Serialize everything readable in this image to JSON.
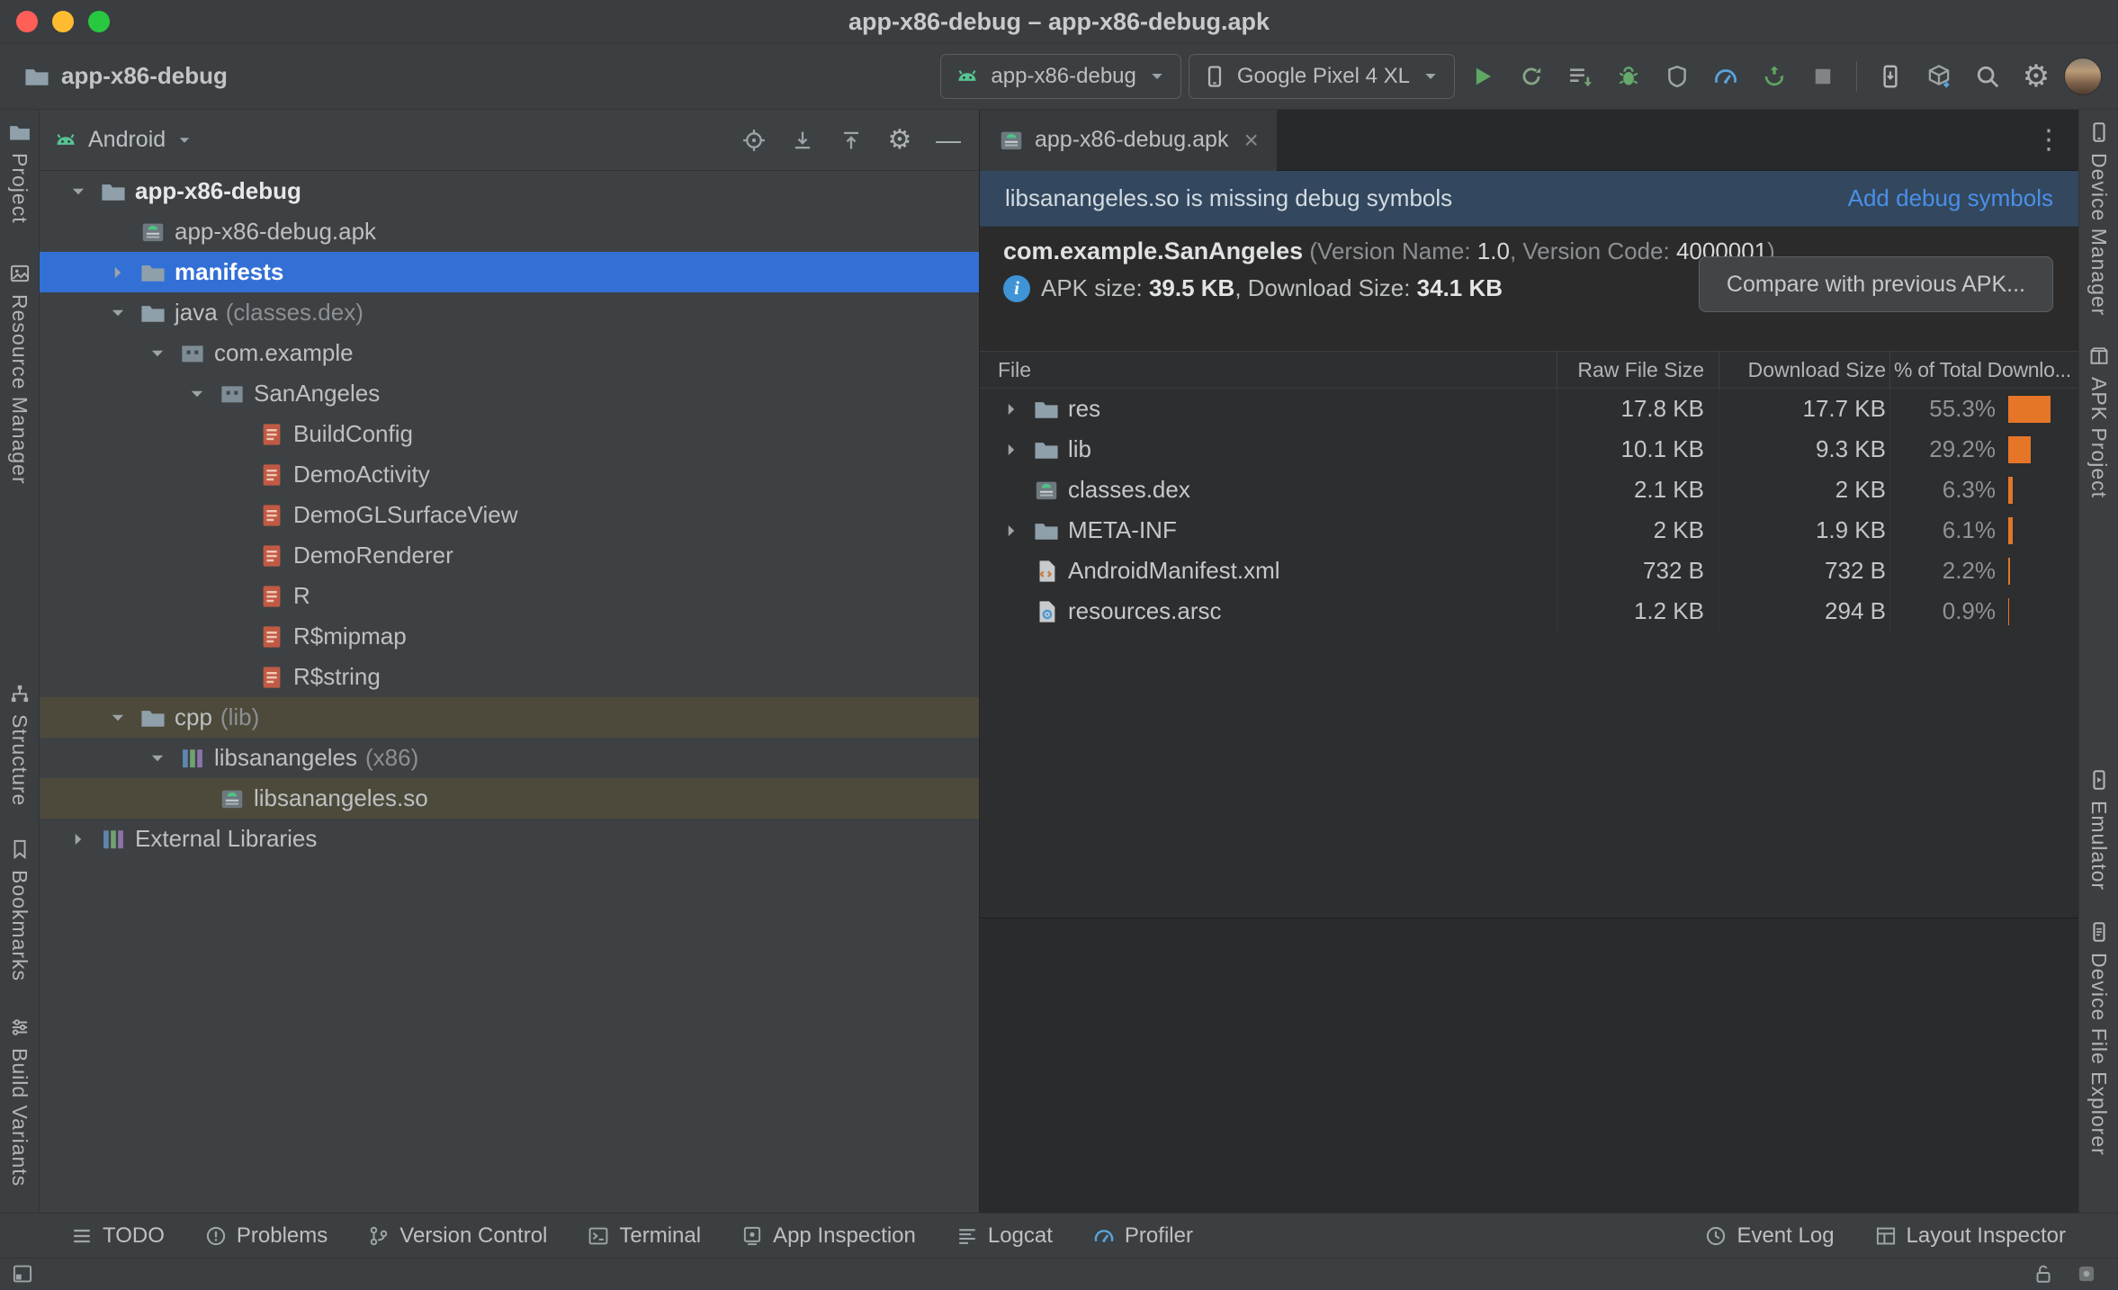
{
  "window": {
    "title": "app-x86-debug – app-x86-debug.apk"
  },
  "toolbar": {
    "project_name": "app-x86-debug",
    "run_config": "app-x86-debug",
    "device": "Google Pixel 4 XL",
    "action_icons": [
      "run",
      "rerun",
      "apply-changes",
      "debug",
      "coverage",
      "profiler",
      "sync",
      "stop",
      "running-devices",
      "device-manager",
      "search",
      "settings",
      "avatar"
    ]
  },
  "stripes": {
    "left": [
      {
        "name": "project",
        "label": "Project"
      },
      {
        "name": "resource-manager",
        "label": "Resource Manager"
      },
      {
        "name": "structure",
        "label": "Structure"
      },
      {
        "name": "bookmarks",
        "label": "Bookmarks"
      },
      {
        "name": "build-variants",
        "label": "Build Variants"
      }
    ],
    "right": [
      {
        "name": "device-manager",
        "label": "Device Manager"
      },
      {
        "name": "apk-project",
        "label": "APK Project"
      },
      {
        "name": "emulator",
        "label": "Emulator"
      },
      {
        "name": "device-file-explorer",
        "label": "Device File Explorer"
      }
    ]
  },
  "project_panel": {
    "view": "Android",
    "tree": [
      {
        "label": "app-x86-debug",
        "depth": 0,
        "chevron": "down",
        "icon": "folder",
        "bold": true
      },
      {
        "label": "app-x86-debug.apk",
        "depth": 1,
        "icon": "apk"
      },
      {
        "label": "manifests",
        "depth": 1,
        "chevron": "right",
        "icon": "folder",
        "bold": true,
        "state": "selected"
      },
      {
        "label": "java",
        "secondary": "(classes.dex)",
        "depth": 1,
        "chevron": "down",
        "icon": "folder"
      },
      {
        "label": "com.example",
        "depth": 2,
        "chevron": "down",
        "icon": "package"
      },
      {
        "label": "SanAngeles",
        "depth": 3,
        "chevron": "down",
        "icon": "package"
      },
      {
        "label": "BuildConfig",
        "depth": 4,
        "icon": "class"
      },
      {
        "label": "DemoActivity",
        "depth": 4,
        "icon": "class"
      },
      {
        "label": "DemoGLSurfaceView",
        "depth": 4,
        "icon": "class"
      },
      {
        "label": "DemoRenderer",
        "depth": 4,
        "icon": "class"
      },
      {
        "label": "R",
        "depth": 4,
        "icon": "class"
      },
      {
        "label": "R$mipmap",
        "depth": 4,
        "icon": "class"
      },
      {
        "label": "R$string",
        "depth": 4,
        "icon": "class"
      },
      {
        "label": "cpp",
        "secondary": "(lib)",
        "depth": 1,
        "chevron": "down",
        "icon": "folder",
        "state": "context"
      },
      {
        "label": "libsanangeles",
        "secondary": "(x86)",
        "depth": 2,
        "chevron": "down",
        "icon": "library"
      },
      {
        "label": "libsanangeles.so",
        "depth": 3,
        "icon": "apk",
        "state": "context"
      },
      {
        "label": "External Libraries",
        "depth": 0,
        "chevron": "right",
        "icon": "library"
      }
    ]
  },
  "editor": {
    "tab": "app-x86-debug.apk",
    "banner": {
      "message": "libsanangeles.so is missing debug symbols",
      "action": "Add debug symbols"
    },
    "summary": {
      "package": "com.example.SanAngeles",
      "meta_open": "(Version Name: ",
      "version_name": "1.0",
      "meta_mid": ", Version Code: ",
      "version_code": "4000001",
      "meta_close": ")",
      "apk_size_label": "APK size: ",
      "apk_size": "39.5 KB",
      "download_size_label": ", Download Size: ",
      "download_size": "34.1 KB",
      "compare_button": "Compare with previous APK..."
    },
    "table": {
      "columns": [
        "File",
        "Raw File Size",
        "Download Size",
        "% of Total Downlo..."
      ],
      "rows": [
        {
          "name": "res",
          "icon": "folder",
          "expandable": true,
          "raw": "17.8 KB",
          "download": "17.7 KB",
          "percent": "55.3%",
          "percent_value": 55.3
        },
        {
          "name": "lib",
          "icon": "folder",
          "expandable": true,
          "raw": "10.1 KB",
          "download": "9.3 KB",
          "percent": "29.2%",
          "percent_value": 29.2
        },
        {
          "name": "classes.dex",
          "icon": "dex",
          "expandable": false,
          "raw": "2.1 KB",
          "download": "2 KB",
          "percent": "6.3%",
          "percent_value": 6.3
        },
        {
          "name": "META-INF",
          "icon": "folder",
          "expandable": true,
          "raw": "2 KB",
          "download": "1.9 KB",
          "percent": "6.1%",
          "percent_value": 6.1
        },
        {
          "name": "AndroidManifest.xml",
          "icon": "xml",
          "expandable": false,
          "raw": "732 B",
          "download": "732 B",
          "percent": "2.2%",
          "percent_value": 2.2
        },
        {
          "name": "resources.arsc",
          "icon": "arsc",
          "expandable": false,
          "raw": "1.2 KB",
          "download": "294 B",
          "percent": "0.9%",
          "percent_value": 0.9
        }
      ]
    }
  },
  "bottom_bar": {
    "left": [
      {
        "name": "todo",
        "label": "TODO"
      },
      {
        "name": "problems",
        "label": "Problems"
      },
      {
        "name": "version-control",
        "label": "Version Control"
      },
      {
        "name": "terminal",
        "label": "Terminal"
      },
      {
        "name": "app-inspection",
        "label": "App Inspection"
      },
      {
        "name": "logcat",
        "label": "Logcat"
      },
      {
        "name": "profiler",
        "label": "Profiler"
      }
    ],
    "right": [
      {
        "name": "event-log",
        "label": "Event Log"
      },
      {
        "name": "layout-inspector",
        "label": "Layout Inspector"
      }
    ]
  },
  "colors": {
    "selection_blue": "#3270d6",
    "context_highlight": "#4e4a3b",
    "banner_bg": "#33485e",
    "link_blue": "#4a8fe8",
    "bar_orange": "#e57627",
    "android_green": "#57c392"
  }
}
